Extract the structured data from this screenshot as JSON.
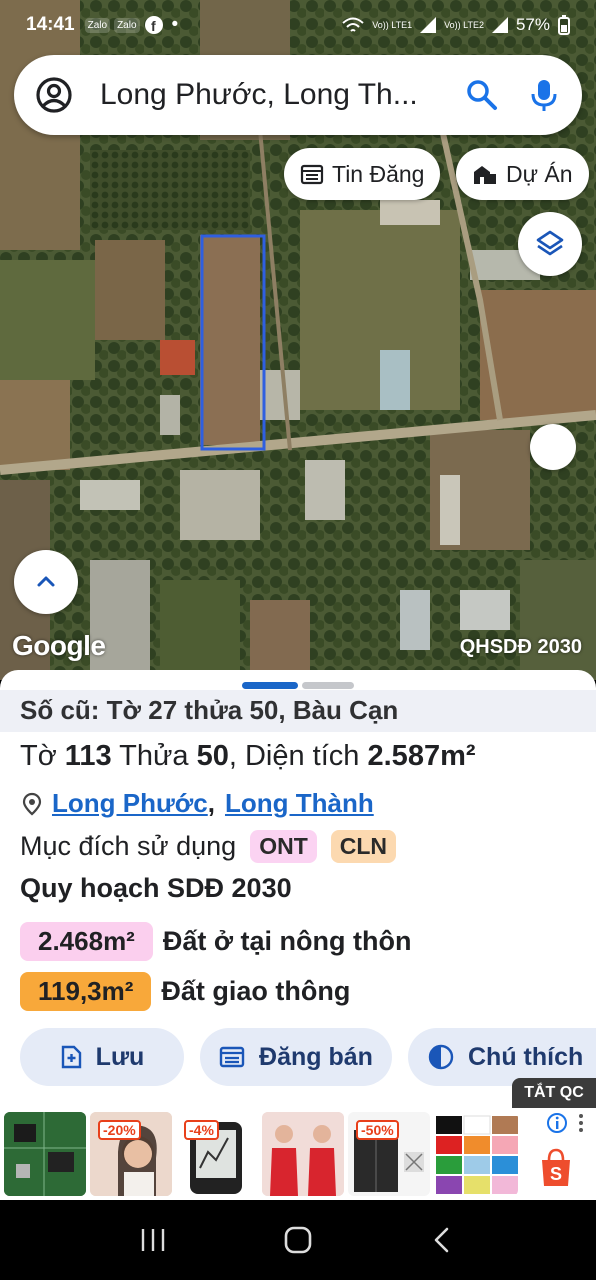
{
  "status_bar": {
    "time": "14:41",
    "app_icons": [
      "Zalo",
      "Zalo"
    ],
    "network1": "Vo)) LTE1",
    "network2": "Vo)) LTE2",
    "battery": "57%"
  },
  "search": {
    "query": "Long Phước, Long Th...",
    "avatar_icon": "account-icon",
    "search_icon": "search-icon",
    "mic_icon": "mic-icon"
  },
  "chips": [
    {
      "label": "Tin Đăng",
      "icon": "calendar-list-icon"
    },
    {
      "label": "Dự Án",
      "icon": "buildings-icon"
    }
  ],
  "map": {
    "layers_icon": "layers-icon",
    "expand_icon": "chevron-up-icon",
    "watermark": "Google",
    "overlay_label": "QHSDĐ 2030",
    "parcel_outline_color": "#2f5fe0"
  },
  "sheet": {
    "old_ref": "Số cũ: Tờ 27 thửa 50, Bàu Cạn",
    "sheet_label": "Tờ",
    "sheet_no": "113",
    "plot_label": "Thửa",
    "plot_no": "50",
    "area_label": "Diện tích",
    "area_value": "2.587m²",
    "location": {
      "commune": "Long Phước",
      "district": "Long Thành",
      "separator": ","
    },
    "purpose_label": "Mục đích sử dụng",
    "purpose_tags": [
      {
        "code": "ONT",
        "color": "#fbd3f2"
      },
      {
        "code": "CLN",
        "color": "#fcd9b0"
      }
    ],
    "plan_title": "Quy hoạch SDĐ 2030",
    "plans": [
      {
        "area": "2.468m²",
        "desc": "Đất ở tại nông thôn",
        "color": "#fbcfee"
      },
      {
        "area": "119,3m²",
        "desc": "Đất giao thông",
        "color": "#f8a83a"
      }
    ],
    "actions": [
      {
        "label": "Lưu",
        "icon": "save-add-icon"
      },
      {
        "label": "Đăng bán",
        "icon": "post-listing-icon"
      },
      {
        "label": "Chú thích",
        "icon": "contrast-icon"
      }
    ]
  },
  "ad": {
    "hide_label": "TẮT QC",
    "items": [
      {
        "discount": ""
      },
      {
        "discount": "-20%"
      },
      {
        "discount": "-4%"
      },
      {
        "discount": ""
      },
      {
        "discount": "-50%"
      },
      {
        "discount": ""
      }
    ],
    "info_icon": "info-icon",
    "more_icon": "more-vert-icon",
    "shop_icon": "shopee-bag-icon"
  },
  "nav": {
    "recents": "recents-icon",
    "home": "home-icon",
    "back": "back-icon"
  }
}
